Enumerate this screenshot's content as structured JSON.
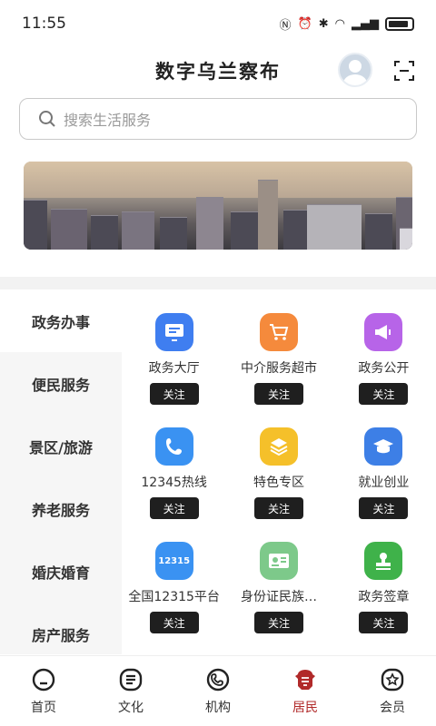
{
  "status": {
    "time": "11:55"
  },
  "header": {
    "title": "数字乌兰察布"
  },
  "search": {
    "placeholder": "搜索生活服务"
  },
  "sidebar": {
    "items": [
      {
        "label": "政务办事"
      },
      {
        "label": "便民服务"
      },
      {
        "label": "景区/旅游"
      },
      {
        "label": "养老服务"
      },
      {
        "label": "婚庆婚育"
      },
      {
        "label": "房产服务"
      }
    ]
  },
  "services": [
    {
      "label": "政务大厅",
      "icon": "monitor-icon",
      "color": "#3f7ef0",
      "follow": "关注"
    },
    {
      "label": "中介服务超市",
      "icon": "cart-icon",
      "color": "#f58a3c",
      "follow": "关注"
    },
    {
      "label": "政务公开",
      "icon": "megaphone-icon",
      "color": "#b764e8",
      "follow": "关注"
    },
    {
      "label": "12345热线",
      "icon": "phone-icon",
      "color": "#3a92f2",
      "follow": "关注"
    },
    {
      "label": "特色专区",
      "icon": "layers-icon",
      "color": "#f5c02a",
      "follow": "关注"
    },
    {
      "label": "就业创业",
      "icon": "graduation-icon",
      "color": "#3d7fe6",
      "follow": "关注"
    },
    {
      "label": "全国12315平台",
      "icon": "12315-icon",
      "color": "#3a92f2",
      "follow": "关注",
      "badge": "12315"
    },
    {
      "label": "身份证民族…",
      "icon": "id-card-icon",
      "color": "#7dc98a",
      "follow": "关注"
    },
    {
      "label": "政务签章",
      "icon": "stamp-icon",
      "color": "#3fb24a",
      "follow": "关注"
    }
  ],
  "nav": {
    "items": [
      {
        "label": "首页"
      },
      {
        "label": "文化"
      },
      {
        "label": "机构"
      },
      {
        "label": "居民"
      },
      {
        "label": "会员"
      }
    ]
  }
}
